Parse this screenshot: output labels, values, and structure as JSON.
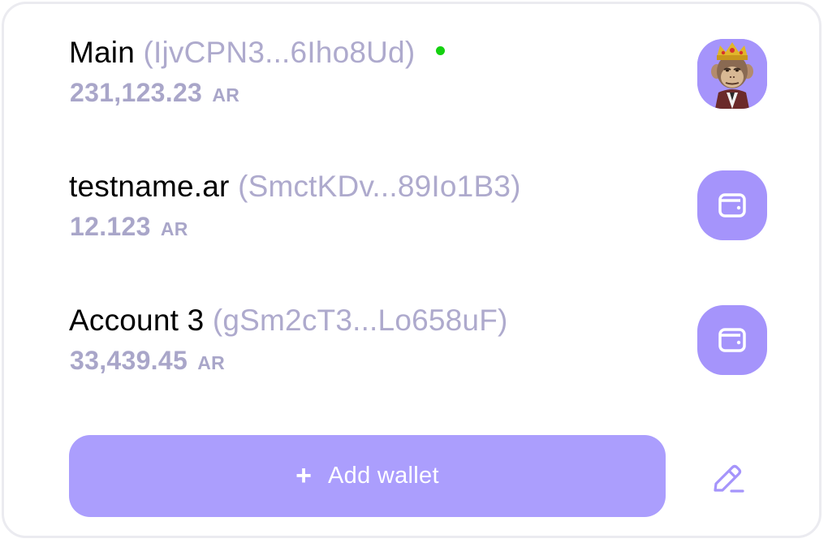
{
  "wallets": [
    {
      "label": "Main",
      "address": "(IjvCPN3...6Iho8Ud)",
      "balance": "231,123.23",
      "ticker": "AR",
      "active": true,
      "icon": "avatar-ape-nft"
    },
    {
      "label": "testname.ar",
      "address": "(SmctKDv...89Io1B3)",
      "balance": "12.123",
      "ticker": "AR",
      "active": false,
      "icon": "wallet-icon"
    },
    {
      "label": "Account 3",
      "address": "(gSm2cT3...Lo658uF)",
      "balance": "33,439.45",
      "ticker": "AR",
      "active": false,
      "icon": "wallet-icon"
    }
  ],
  "actions": {
    "add_wallet_icon": "+",
    "add_wallet_label": "Add wallet",
    "edit_icon": "edit-pencil-icon"
  },
  "colors": {
    "accent": "#a594fb",
    "button": "#ab9efd",
    "muted_text": "#aeaacd",
    "active_dot": "#14d110",
    "border": "#ebebf0"
  }
}
